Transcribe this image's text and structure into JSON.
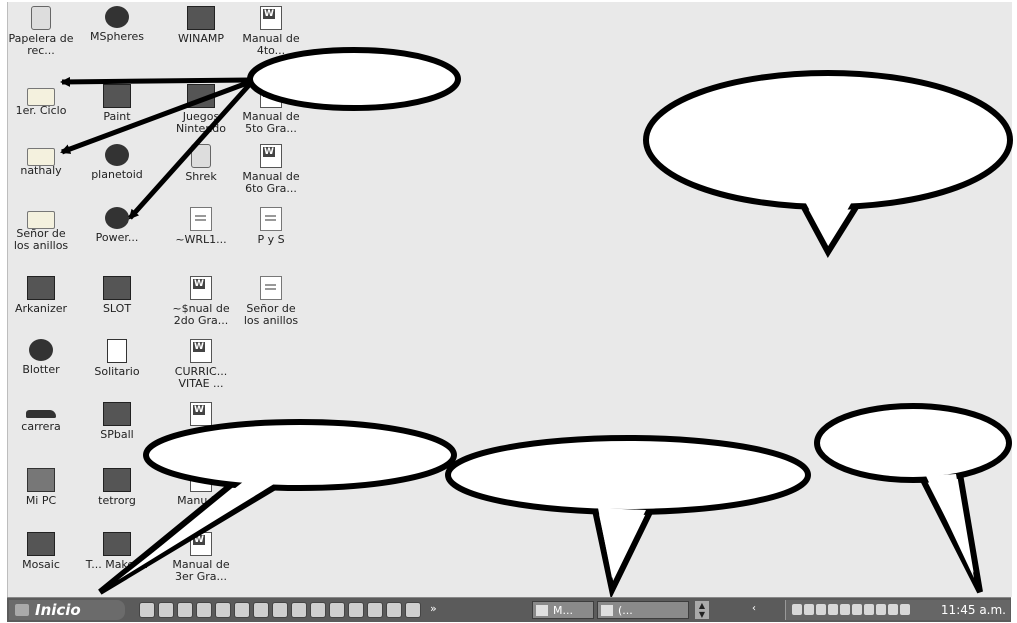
{
  "desktop": {
    "icons": [
      {
        "label": "Papelera de rec...",
        "icon": "recycle-bin-icon"
      },
      {
        "label": "MSpheres",
        "icon": "mspheres-icon"
      },
      {
        "label": "WINAMP",
        "icon": "winamp-icon"
      },
      {
        "label": "Manual de 4to...",
        "icon": "word-document-icon"
      },
      {
        "label": "1er. Ciclo",
        "icon": "folder-icon"
      },
      {
        "label": "Paint",
        "icon": "paint-icon"
      },
      {
        "label": "Juegos Nintendo",
        "icon": "games-icon"
      },
      {
        "label": "Manual de 5to Gra...",
        "icon": "word-document-icon"
      },
      {
        "label": "nathaly",
        "icon": "folder-icon"
      },
      {
        "label": "planetoid",
        "icon": "planetoid-icon"
      },
      {
        "label": "Shrek",
        "icon": "shrek-icon"
      },
      {
        "label": "Manual de 6to Gra...",
        "icon": "word-document-icon"
      },
      {
        "label": "Señor de los anillos",
        "icon": "folder-icon"
      },
      {
        "label": "Power...",
        "icon": "power-icon"
      },
      {
        "label": "~WRL1...",
        "icon": "text-file-icon"
      },
      {
        "label": "P y S",
        "icon": "document-icon"
      },
      {
        "label": "Arkanizer",
        "icon": "arkanizer-icon"
      },
      {
        "label": "SLOT",
        "icon": "slot-icon"
      },
      {
        "label": "~$nual de 2do Gra...",
        "icon": "word-document-icon"
      },
      {
        "label": "Señor de los anillos",
        "icon": "document-icon"
      },
      {
        "label": "Blotter",
        "icon": "blotter-icon"
      },
      {
        "label": "Solitario",
        "icon": "solitaire-icon"
      },
      {
        "label": "CURRIC... VITAE ...",
        "icon": "word-document-icon"
      },
      {
        "label": "carrera",
        "icon": "car-icon"
      },
      {
        "label": "SPball",
        "icon": "spball-icon"
      },
      {
        "label": "",
        "icon": "word-document-icon"
      },
      {
        "label": "Mi PC",
        "icon": "my-computer-icon"
      },
      {
        "label": "tetrorg",
        "icon": "tetrorg-icon"
      },
      {
        "label": "Manu 2d",
        "icon": "word-document-icon"
      },
      {
        "label": "Mosaic",
        "icon": "mosaic-icon"
      },
      {
        "label": "T... Maker...",
        "icon": "maker-icon"
      },
      {
        "label": "Manual de 3er Gra...",
        "icon": "word-document-icon"
      }
    ]
  },
  "taskbar": {
    "start_label": "Inicio",
    "quick_launch_more": "»",
    "tasks": [
      {
        "label": "M..."
      },
      {
        "label": "(..."
      }
    ],
    "clock": "11:45 a.m."
  },
  "colors": {
    "desktop": "#e9e9e9",
    "taskbar": "#5b5b5b",
    "bubble_fill": "#ffffff",
    "bubble_stroke": "#000000"
  }
}
